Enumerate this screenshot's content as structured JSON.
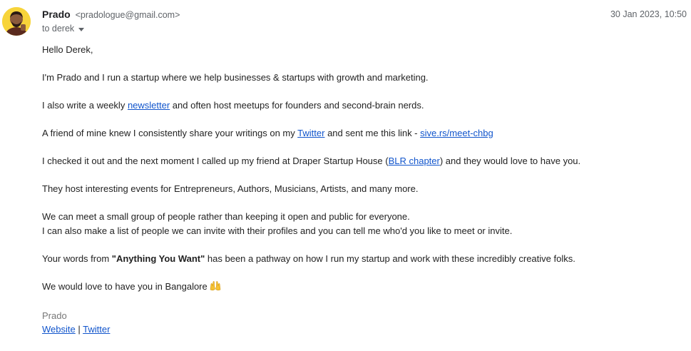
{
  "sender": {
    "name": "Prado",
    "email": "<pradologue@gmail.com>"
  },
  "date": "30 Jan 2023, 10:50",
  "recipient": "to derek",
  "icons": {
    "avatar": "avatar-photo",
    "recipient_toggle": "caret-down-icon",
    "emoji": "raising-hands-emoji"
  },
  "colors": {
    "link": "#1155cc",
    "avatar_bg": "#f7d43a"
  },
  "body": {
    "greeting": "Hello Derek,",
    "p1": "I'm Prado and I run a startup where we help businesses & startups with growth and marketing.",
    "p2": {
      "before": "I also write a weekly ",
      "link": "newsletter",
      "after": " and often host meetups for founders and second-brain nerds."
    },
    "p3": {
      "before": "A friend of mine knew I consistently share your writings on my ",
      "link1": "Twitter",
      "middle": " and sent me this link - ",
      "link2": "sive.rs/meet-chbg"
    },
    "p4": {
      "before": "I checked it out and the next moment I called up my friend at Draper Startup House (",
      "link": "BLR chapter",
      "after": ") and they would love to have you."
    },
    "p5": "They host interesting events for Entrepreneurs, Authors, Musicians, Artists, and many more.",
    "p6": {
      "line1": "We can meet a small group of people rather than keeping it open and public for everyone.",
      "line2": "I can also make a list of people we can invite with their profiles and you can tell me who'd you like to meet or invite."
    },
    "p7": {
      "before": "Your words from ",
      "bold": "\"Anything You Want\"",
      "after": " has been a pathway on how I run my startup and work with these incredibly creative folks."
    },
    "p8": "We would love to have you in Bangalore"
  },
  "signature": {
    "name": "Prado",
    "website_link": "Website",
    "separator": " | ",
    "twitter_link": "Twitter"
  }
}
